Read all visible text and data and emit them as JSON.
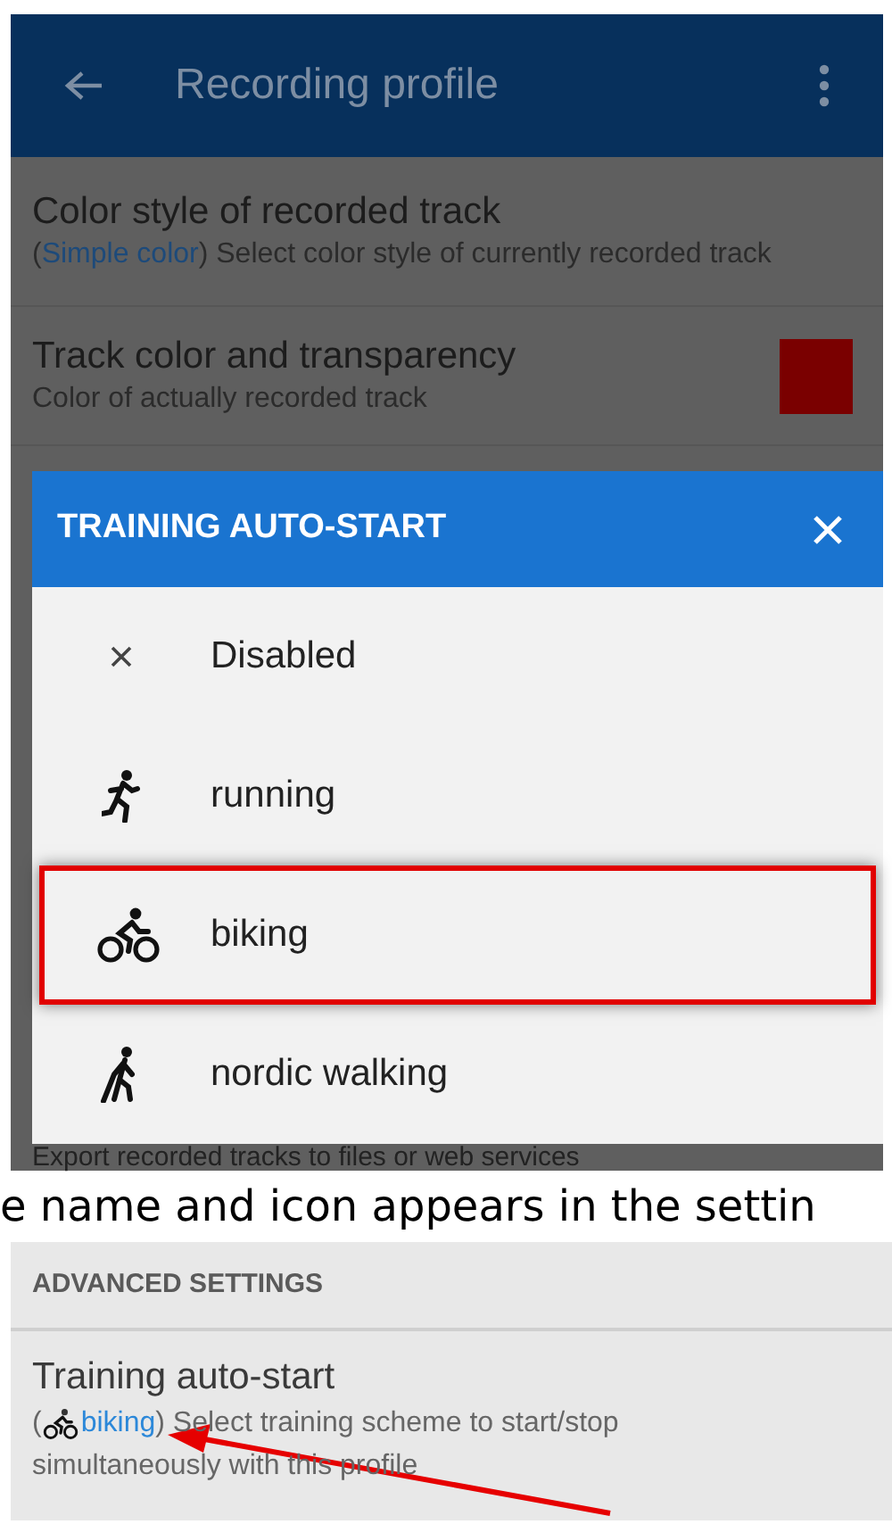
{
  "screen_1": {
    "app_bar": {
      "title": "Recording profile"
    },
    "settings": [
      {
        "title": "Color style of recorded track",
        "value": "Simple color",
        "prefix": "(",
        "description": ") Select color style of currently recorded track"
      },
      {
        "title": "Track color and transparency",
        "description": "Color of actually recorded track",
        "color": "#7a0000"
      }
    ],
    "dialog": {
      "title": "TRAINING AUTO-START",
      "options": [
        {
          "kind": "none",
          "label": "Disabled",
          "highlighted": false
        },
        {
          "kind": "running",
          "label": "running",
          "highlighted": false
        },
        {
          "kind": "biking",
          "label": "biking",
          "highlighted": true
        },
        {
          "kind": "nordic",
          "label": "nordic walking",
          "highlighted": false
        }
      ]
    },
    "behind_dialog_text": "Export recorded tracks to files or web services"
  },
  "caption": "e name and icon appears in the settin",
  "screen_2": {
    "section_header": "ADVANCED SETTINGS",
    "setting": {
      "title": "Training auto-start",
      "prefix": "(",
      "kind": "biking",
      "value": "biking",
      "description_lines": [
        ") Select training scheme to start/stop",
        "simultaneously with this profile"
      ]
    },
    "arrow": true
  }
}
